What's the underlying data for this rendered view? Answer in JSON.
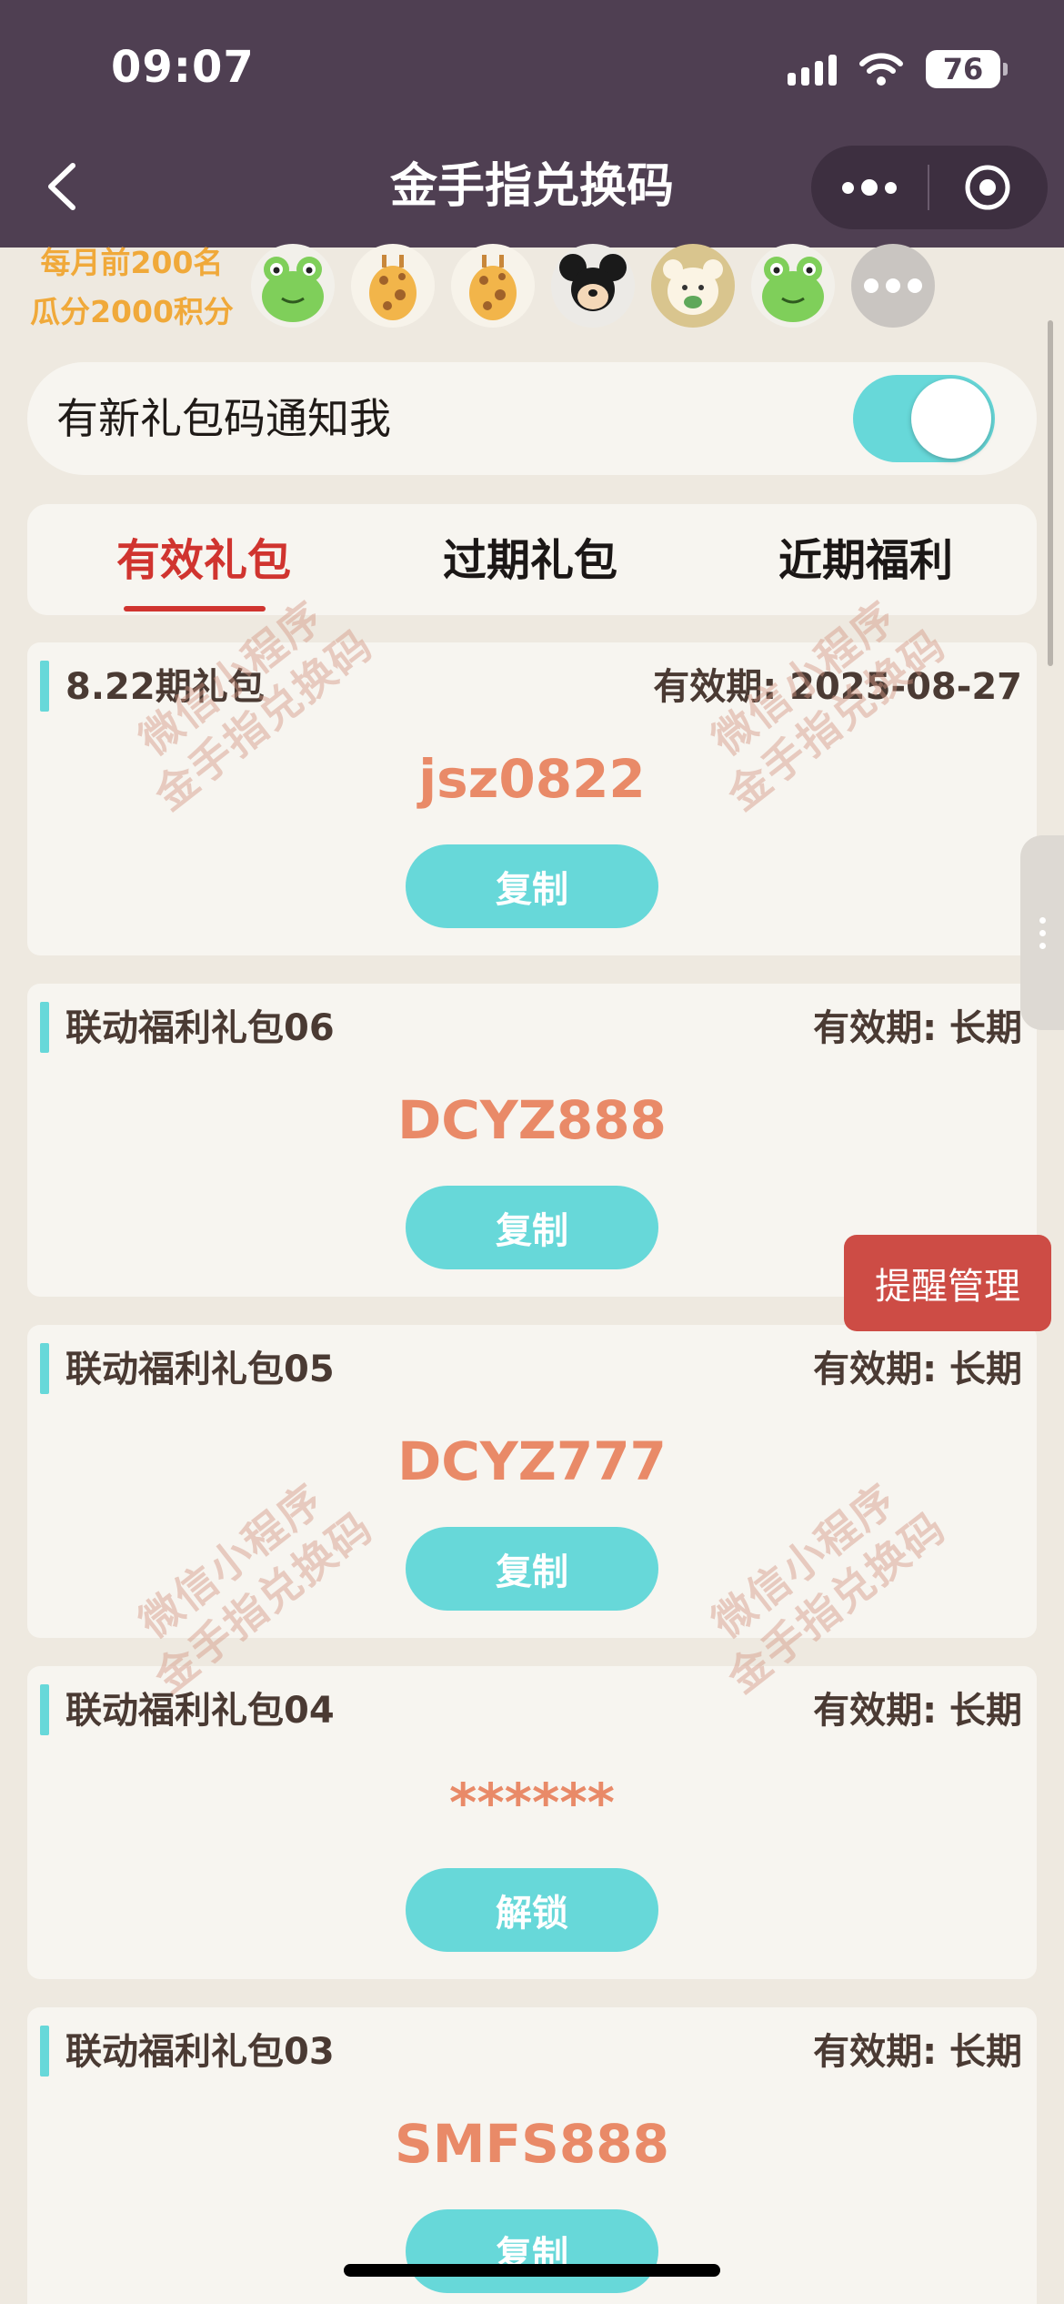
{
  "status_bar": {
    "time": "09:07",
    "battery": "76",
    "icons": [
      "signal-icon",
      "wifi-icon",
      "battery-icon"
    ]
  },
  "nav": {
    "title": "金手指兑换码",
    "back_icon": "chevron-left-icon",
    "menu_icon": "more-dots-icon",
    "close_icon": "target-circle-icon"
  },
  "ranking": {
    "line1": "每月前200名",
    "line2": "瓜分2000积分",
    "avatars": [
      "frog-avatar",
      "giraffe-avatar",
      "giraffe-avatar",
      "mickey-avatar",
      "bear-avatar",
      "frog-avatar",
      "more-avatar"
    ]
  },
  "notify": {
    "label": "有新礼包码通知我",
    "enabled": true
  },
  "tabs": [
    {
      "label": "有效礼包",
      "active": true
    },
    {
      "label": "过期礼包",
      "active": false
    },
    {
      "label": "近期福利",
      "active": false
    }
  ],
  "cards": [
    {
      "name": "8.22期礼包",
      "valid": "有效期: 2025-08-27",
      "code": "jsz0822",
      "button": "复制"
    },
    {
      "name": "联动福利礼包06",
      "valid": "有效期: 长期",
      "code": "DCYZ888",
      "button": "复制"
    },
    {
      "name": "联动福利礼包05",
      "valid": "有效期: 长期",
      "code": "DCYZ777",
      "button": "复制"
    },
    {
      "name": "联动福利礼包04",
      "valid": "有效期: 长期",
      "code": "******",
      "button": "解锁"
    },
    {
      "name": "联动福利礼包03",
      "valid": "有效期: 长期",
      "code": "SMFS888",
      "button": "复制"
    }
  ],
  "watermark": {
    "line1": "微信小程序",
    "line2": "金手指兑换码"
  },
  "floating": {
    "remind_label": "提醒管理"
  },
  "colors": {
    "header_bg": "#4f3f52",
    "page_bg": "#eee9e0",
    "accent_teal": "#67d8d9",
    "active_red": "#d0342f",
    "code_orange": "#e98a68",
    "ranking_orange": "#f0a93a",
    "remind_red": "#cd4c45"
  }
}
